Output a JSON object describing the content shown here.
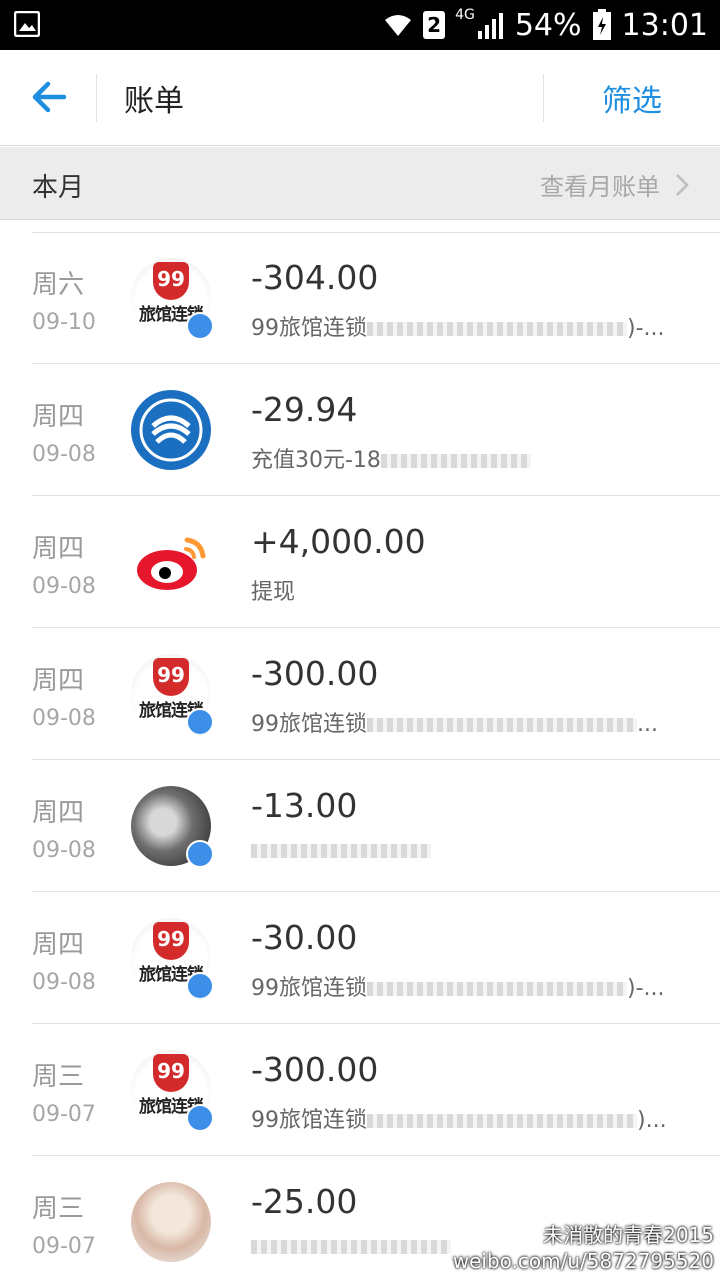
{
  "status_bar": {
    "signal_label": "4G",
    "sim_slot": "2",
    "battery_percent": "54%",
    "time": "13:01",
    "icons": [
      "image-icon",
      "wifi-icon",
      "sim-icon",
      "signal-icon",
      "battery-icon"
    ]
  },
  "header": {
    "title": "账单",
    "filter_label": "筛选",
    "back_icon": "back-arrow-icon",
    "accent_color": "#1e8fe0"
  },
  "month_bar": {
    "label": "本月",
    "link_label": "查看月账单"
  },
  "transactions": [
    {
      "day": "周六",
      "date": "09-10",
      "amount": "-304.00",
      "desc": "99旅馆连锁",
      "desc_tail": ")-...",
      "avatar": "99-hotel-logo",
      "verified": true
    },
    {
      "day": "周四",
      "date": "09-08",
      "amount": "-29.94",
      "desc": "充值30元-18",
      "desc_tail": "",
      "avatar": "china-mobile-logo",
      "verified": false
    },
    {
      "day": "周四",
      "date": "09-08",
      "amount": "+4,000.00",
      "desc": "提现",
      "desc_tail": "",
      "avatar": "weibo-logo",
      "verified": false
    },
    {
      "day": "周四",
      "date": "09-08",
      "amount": "-300.00",
      "desc": "99旅馆连锁",
      "desc_tail": "...",
      "avatar": "99-hotel-logo",
      "verified": true
    },
    {
      "day": "周四",
      "date": "09-08",
      "amount": "-13.00",
      "desc": "",
      "desc_tail": "",
      "avatar": "user-photo",
      "verified": true
    },
    {
      "day": "周四",
      "date": "09-08",
      "amount": "-30.00",
      "desc": "99旅馆连锁",
      "desc_tail": ")-...",
      "avatar": "99-hotel-logo",
      "verified": true
    },
    {
      "day": "周三",
      "date": "09-07",
      "amount": "-300.00",
      "desc": "99旅馆连锁",
      "desc_tail": ")...",
      "avatar": "99-hotel-logo",
      "verified": true
    },
    {
      "day": "周三",
      "date": "09-07",
      "amount": "-25.00",
      "desc": "",
      "desc_tail": "",
      "avatar": "user-photo",
      "verified": false
    }
  ],
  "avatar_text": {
    "hotel_badge": "99",
    "hotel_name": "旅馆连锁"
  },
  "watermark": {
    "line1": "未消散的青春2015",
    "line2": "weibo.com/u/5872795520"
  }
}
